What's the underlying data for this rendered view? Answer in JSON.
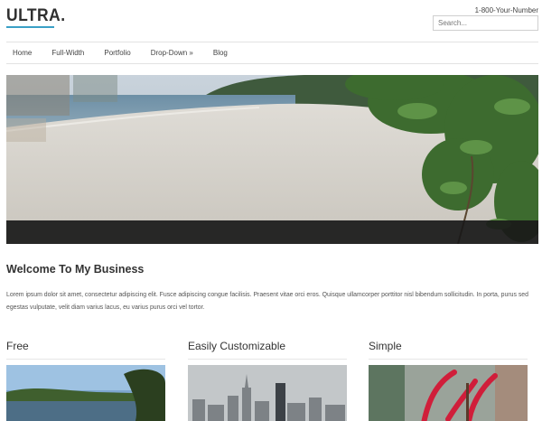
{
  "header": {
    "logo": "ULTRA.",
    "phone": "1-800-Your-Number",
    "search_placeholder": "Search..."
  },
  "nav": {
    "items": [
      {
        "label": "Home"
      },
      {
        "label": "Full-Width"
      },
      {
        "label": "Portfolio"
      },
      {
        "label": "Drop-Down »"
      },
      {
        "label": "Blog"
      }
    ]
  },
  "hero": {
    "image": "beach-photo",
    "caption_bar_color": "#1a1a1a"
  },
  "content": {
    "title": "Welcome To My Business",
    "text": "Lorem ipsum dolor sit amet, consectetur adipiscing elit. Fusce adipiscing congue facilisis. Praesent vitae orci eros. Quisque ullamcorper porttitor nisl bibendum sollicitudin. In porta, purus sed egestas vulputate, velit diam varius lacus, eu varius purus orci vel tortor."
  },
  "features": [
    {
      "title": "Free",
      "image": "lake-photo"
    },
    {
      "title": "Easily Customizable",
      "image": "city-photo"
    },
    {
      "title": "Simple",
      "image": "red-plant-photo"
    }
  ],
  "colors": {
    "accent": "#3aa0c6",
    "text": "#333333",
    "rule": "#e2e2e2"
  }
}
